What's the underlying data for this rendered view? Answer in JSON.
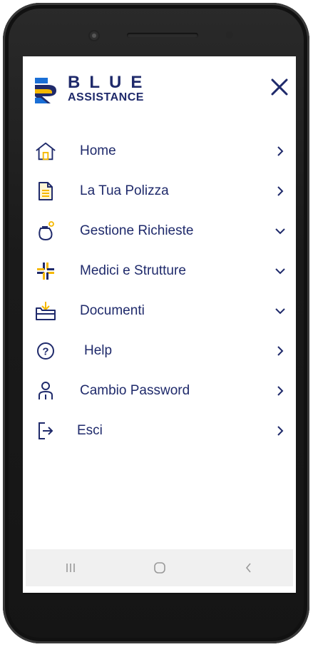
{
  "brand": {
    "line1": "BLUE",
    "line2": "ASSISTANCE"
  },
  "menu": {
    "items": [
      {
        "label": "Home",
        "icon": "home-icon",
        "arrow": "chevron-right"
      },
      {
        "label": "La Tua Polizza",
        "icon": "document-icon",
        "arrow": "chevron-right"
      },
      {
        "label": "Gestione Richieste",
        "icon": "requests-icon",
        "arrow": "chevron-down"
      },
      {
        "label": "Medici e Strutture",
        "icon": "medical-cross-icon",
        "arrow": "chevron-down"
      },
      {
        "label": "Documenti",
        "icon": "download-folder-icon",
        "arrow": "chevron-down"
      },
      {
        "label": "Help",
        "icon": "help-icon",
        "arrow": "chevron-right"
      },
      {
        "label": "Cambio Password",
        "icon": "user-icon",
        "arrow": "chevron-right"
      },
      {
        "label": "Esci",
        "icon": "logout-icon",
        "arrow": "chevron-right"
      }
    ]
  },
  "colors": {
    "brand_navy": "#1f2a6b",
    "accent_gold": "#f5b800",
    "accent_blue": "#1a6fd6"
  }
}
